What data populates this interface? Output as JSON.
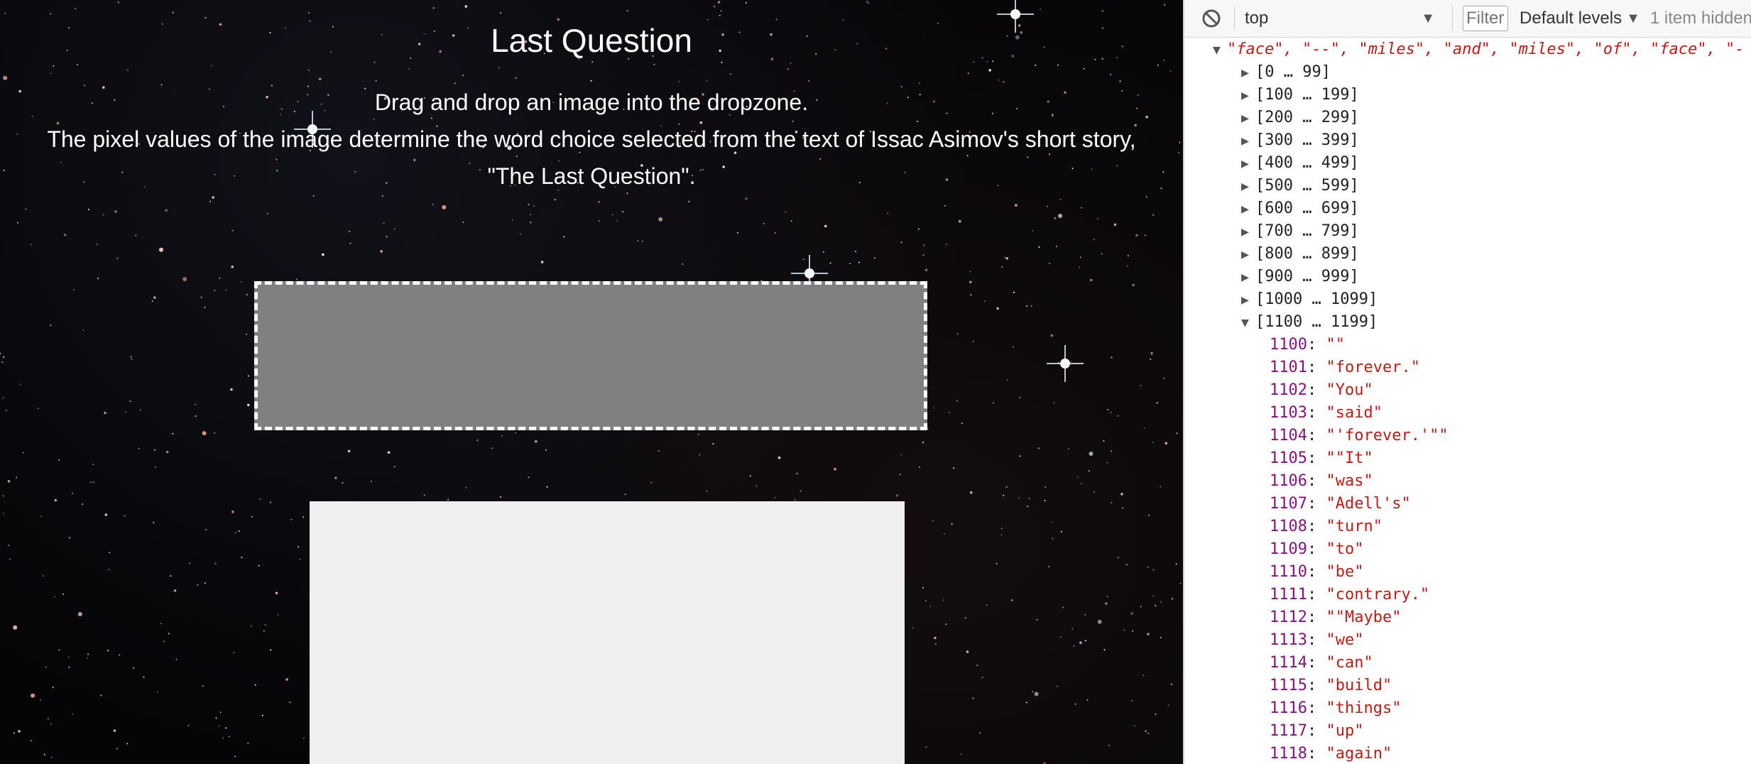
{
  "page": {
    "title": "Last Question",
    "instructions": [
      "Drag and drop an image into the dropzone.",
      "The pixel values of the image determine the word choice selected from the text of Issac Asimov's short story,",
      "\"The Last Question\"."
    ]
  },
  "devtools": {
    "context": "top",
    "filter_placeholder": "Filter",
    "levels": "Default levels",
    "hidden": "1 item hidden",
    "array_preview": "\"face\", \"--\", \"miles\", \"and\", \"miles\", \"of\", \"face\", \"-",
    "groups": [
      "[0 … 99]",
      "[100 … 199]",
      "[200 … 299]",
      "[300 … 399]",
      "[400 … 499]",
      "[500 … 599]",
      "[600 … 699]",
      "[700 … 799]",
      "[800 … 899]",
      "[900 … 999]",
      "[1000 … 1099]",
      "[1100 … 1199]"
    ],
    "entries": [
      {
        "index": "1100",
        "value": "\"\""
      },
      {
        "index": "1101",
        "value": "\"forever.\""
      },
      {
        "index": "1102",
        "value": "\"You\""
      },
      {
        "index": "1103",
        "value": "\"said\""
      },
      {
        "index": "1104",
        "value": "\"'forever.'\"\""
      },
      {
        "index": "1105",
        "value": "\"\"It\""
      },
      {
        "index": "1106",
        "value": "\"was\""
      },
      {
        "index": "1107",
        "value": "\"Adell's\""
      },
      {
        "index": "1108",
        "value": "\"turn\""
      },
      {
        "index": "1109",
        "value": "\"to\""
      },
      {
        "index": "1110",
        "value": "\"be\""
      },
      {
        "index": "1111",
        "value": "\"contrary.\""
      },
      {
        "index": "1112",
        "value": "\"\"Maybe\""
      },
      {
        "index": "1113",
        "value": "\"we\""
      },
      {
        "index": "1114",
        "value": "\"can\""
      },
      {
        "index": "1115",
        "value": "\"build\""
      },
      {
        "index": "1116",
        "value": "\"things\""
      },
      {
        "index": "1117",
        "value": "\"up\""
      },
      {
        "index": "1118",
        "value": "\"again\""
      }
    ]
  }
}
